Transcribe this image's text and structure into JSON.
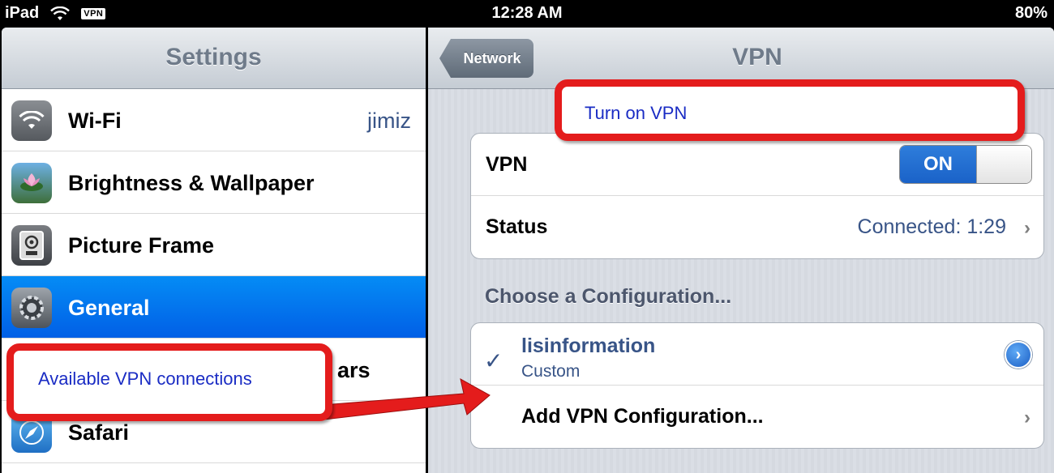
{
  "status_bar": {
    "device": "iPad",
    "vpn_badge": "VPN",
    "time": "12:28 AM",
    "battery": "80%"
  },
  "master": {
    "title": "Settings",
    "items": [
      {
        "label": "Wi-Fi",
        "value": "jimiz",
        "icon": "wifi-icon"
      },
      {
        "label": "Brightness & Wallpaper",
        "value": "",
        "icon": "brightness-icon"
      },
      {
        "label": "Picture Frame",
        "value": "",
        "icon": "picture-frame-icon"
      },
      {
        "label": "General",
        "value": "",
        "icon": "gear-icon",
        "selected": true
      },
      {
        "label": "ars",
        "value": "",
        "icon": "generic-icon"
      },
      {
        "label": "Safari",
        "value": "",
        "icon": "compass-icon"
      }
    ]
  },
  "detail": {
    "back_label": "Network",
    "title": "VPN",
    "vpn_row": {
      "label": "VPN",
      "toggle": "ON"
    },
    "status_row": {
      "label": "Status",
      "value": "Connected: 1:29"
    },
    "section_header": "Choose a Configuration...",
    "configuration": {
      "name": "lisinformation",
      "type": "Custom"
    },
    "add_label": "Add VPN Configuration..."
  },
  "callouts": {
    "top": "Turn on VPN",
    "left": "Available VPN connections"
  },
  "colors": {
    "selection": "#015fe6",
    "detail_text": "#385487",
    "callout_border": "#e41c1c",
    "callout_text": "#1a2cc4"
  }
}
